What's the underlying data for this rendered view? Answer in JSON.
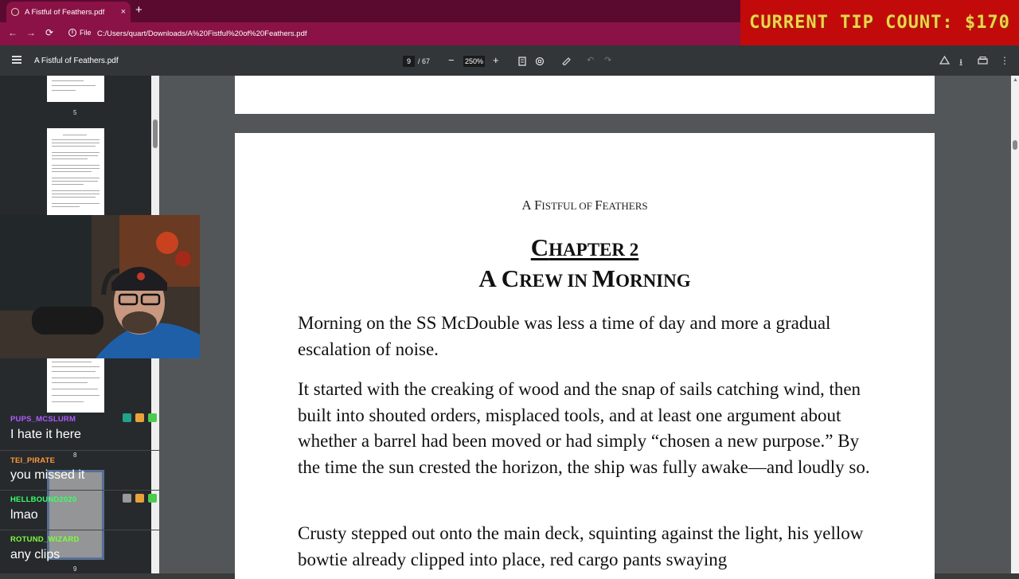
{
  "browser": {
    "tab_title": "A Fistful of Feathers.pdf",
    "tab_close": "×",
    "new_tab": "+",
    "nav": {
      "back": "←",
      "forward": "→",
      "reload": "⟳"
    },
    "file_label": "File",
    "url": "C:/Users/quart/Downloads/A%20Fistful%20of%20Feathers.pdf"
  },
  "tip_overlay": {
    "text": "CURRENT TIP COUNT: $170"
  },
  "pdf_toolbar": {
    "title": "A Fistful of Feathers.pdf",
    "page_current": "9",
    "page_total": "/ 67",
    "zoom": "250%",
    "zoom_out": "−",
    "zoom_in": "+"
  },
  "sidebar": {
    "page_numbers": [
      "5",
      "8",
      "9"
    ]
  },
  "document": {
    "running_head_first": "A F",
    "running_head_rest": "ISTFUL OF ",
    "running_head_f2": "F",
    "running_head_rest2": "EATHERS",
    "chapter_line1_cap": "C",
    "chapter_line1_rest": "HAPTER 2",
    "chapter_line2_a": "A C",
    "chapter_line2_b": "REW IN ",
    "chapter_line2_c": "M",
    "chapter_line2_d": "ORNING",
    "paragraphs": [
      "Morning on the SS McDouble was less a time of day and more a gradual escalation of noise.",
      "It started with the creaking of wood and the snap of sails catching wind, then built into shouted orders, misplaced tools, and at least one argument about whether a barrel had been moved or had simply “chosen a new purpose.” By the time the sun crested the horizon, the ship was fully awake—and loudly so.",
      "Crusty stepped out onto the main deck, squinting against the light, his yellow bowtie already clipped into place, red cargo pants swaying"
    ]
  },
  "chat": [
    {
      "user": "PUPS_MCSLURM",
      "message": "I hate it here",
      "color": "#b05cff"
    },
    {
      "user": "TEI_PIRATE",
      "message": "you missed it",
      "color": "#ff9a3c"
    },
    {
      "user": "HELLBOUND2020",
      "message": "lmao",
      "color": "#3cff6a"
    },
    {
      "user": "ROTUND_WIZARD",
      "message": "any clips",
      "color": "#7dff3a"
    }
  ]
}
